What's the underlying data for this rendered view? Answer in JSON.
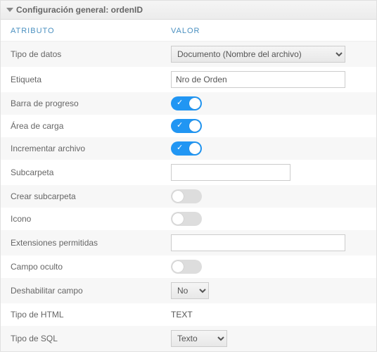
{
  "header": {
    "title": "Configuración general: ordenID"
  },
  "columns": {
    "attr": "ATRIBUTO",
    "val": "VALOR"
  },
  "rows": {
    "tipoDatos": {
      "label": "Tipo de datos",
      "selected": "Documento (Nombre del archivo)"
    },
    "etiqueta": {
      "label": "Etiqueta",
      "value": "Nro de Orden"
    },
    "barraProgreso": {
      "label": "Barra de progreso",
      "on": true
    },
    "areaCarga": {
      "label": "Área de carga",
      "on": true
    },
    "incrementar": {
      "label": "Incrementar archivo",
      "on": true
    },
    "subcarpeta": {
      "label": "Subcarpeta",
      "value": ""
    },
    "crearSub": {
      "label": "Crear subcarpeta",
      "on": false
    },
    "icono": {
      "label": "Icono",
      "on": false
    },
    "extensiones": {
      "label": "Extensiones permitidas",
      "value": ""
    },
    "campoOculto": {
      "label": "Campo oculto",
      "on": false
    },
    "deshabilitar": {
      "label": "Deshabilitar campo",
      "selected": "No"
    },
    "tipoHtml": {
      "label": "Tipo de HTML",
      "value": "TEXT"
    },
    "tipoSql": {
      "label": "Tipo de SQL",
      "selected": "Texto"
    }
  }
}
